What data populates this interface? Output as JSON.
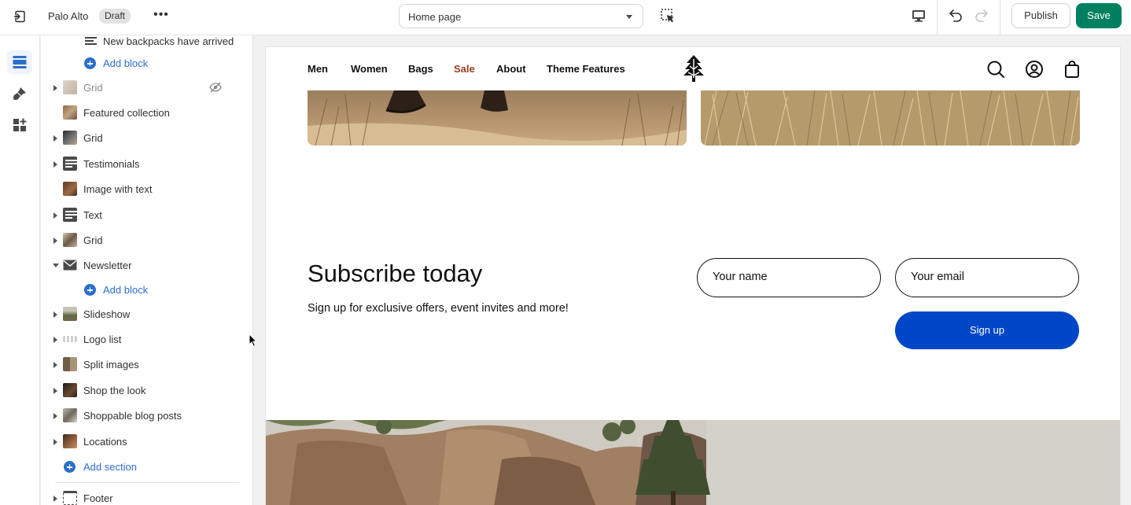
{
  "topbar": {
    "store_name": "Palo Alto",
    "status_badge": "Draft",
    "more_label": "•••",
    "page_selector_value": "Home page",
    "publish_label": "Publish",
    "save_label": "Save"
  },
  "sidebar": {
    "items": [
      {
        "label": "New backpacks have arrived",
        "kind": "block"
      },
      {
        "label": "Add block",
        "kind": "add-block"
      },
      {
        "label": "Grid",
        "kind": "section",
        "hidden": true
      },
      {
        "label": "Featured collection",
        "kind": "section"
      },
      {
        "label": "Grid",
        "kind": "section"
      },
      {
        "label": "Testimonials",
        "kind": "section"
      },
      {
        "label": "Image with text",
        "kind": "section"
      },
      {
        "label": "Text",
        "kind": "section"
      },
      {
        "label": "Grid",
        "kind": "section"
      },
      {
        "label": "Newsletter",
        "kind": "section",
        "expanded": true
      },
      {
        "label": "Add block",
        "kind": "add-block"
      },
      {
        "label": "Slideshow",
        "kind": "section"
      },
      {
        "label": "Logo list",
        "kind": "section"
      },
      {
        "label": "Split images",
        "kind": "section"
      },
      {
        "label": "Shop the look",
        "kind": "section"
      },
      {
        "label": "Shoppable blog posts",
        "kind": "section"
      },
      {
        "label": "Locations",
        "kind": "section"
      },
      {
        "label": "Add section",
        "kind": "add-section"
      },
      {
        "label": "Footer",
        "kind": "section"
      }
    ]
  },
  "preview": {
    "nav": {
      "items": [
        "Men",
        "Women",
        "Bags",
        "Sale",
        "About",
        "Theme Features"
      ],
      "sale_color": "#9b3d1f"
    },
    "newsletter": {
      "title": "Subscribe today",
      "text": "Sign up for exclusive offers, event invites and more!",
      "name_placeholder": "Your name",
      "email_placeholder": "Your email",
      "button_label": "Sign up",
      "button_color": "#0047c7"
    }
  },
  "colors": {
    "accent_blue": "#2c6ecb",
    "save_green": "#008060"
  }
}
